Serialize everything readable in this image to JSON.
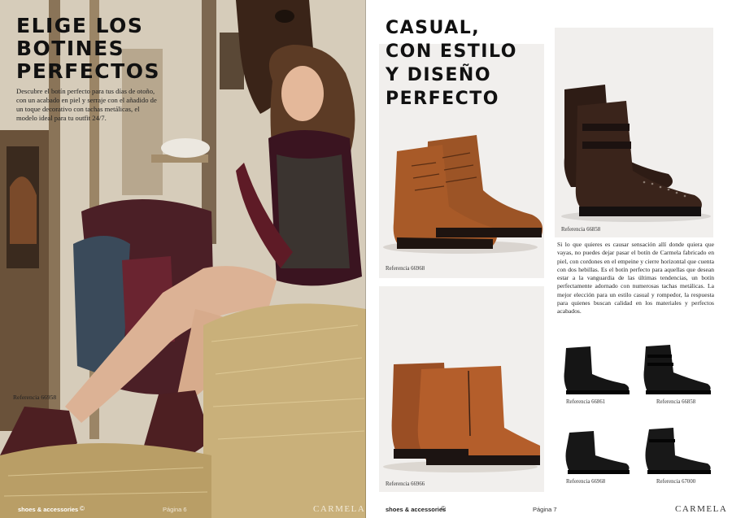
{
  "left_page": {
    "title_lines": [
      "ELIGE LOS",
      "BOTINES",
      "PERFECTOS"
    ],
    "intro": "Descubre el botín perfecto para tus días de otoño, con un acabado en piel y serraje con el añadido de un toque decorativo con tachas metálicas, el modelo ideal para tu outfit 24/7.",
    "reference": "Referencia 66958",
    "footer": {
      "brand": "shoes & accessories",
      "page": "Página 6",
      "logo": "CARMELA"
    }
  },
  "right_page": {
    "title_lines": [
      "CASUAL,",
      "CON ESTILO",
      "Y DISEÑO",
      "PERFECTO"
    ],
    "photos": [
      {
        "reference": "Referencia 66968",
        "color": "#a0562a"
      },
      {
        "reference": "Referencia 66858",
        "color": "#3b231b"
      },
      {
        "reference": "Referencia 66966",
        "color": "#b5602b"
      }
    ],
    "body": "Si lo que quieres es causar sensación allí donde quiera que vayas, no puedes dejar pasar el botín de Carmela fabricado en piel, con cordones en el empeine y cierre horizontal que cuenta con dos hebillas. Es el botín perfecto para aquellas que desean estar a la vanguardia de las últimas tendencias, un botín perfectamente adornado con numerosas tachas metálicas. La mejor elección para un estilo casual y rompedor, la respuesta para quienes buscan calidad en los materiales y perfectos acabados.",
    "mini_boots": [
      {
        "reference": "Referencia 66861"
      },
      {
        "reference": "Referencia 66858"
      },
      {
        "reference": "Referencia 66968"
      },
      {
        "reference": "Referencia 67000"
      }
    ],
    "footer": {
      "brand": "shoes & accessories",
      "page": "Página 7",
      "logo": "CARMELA"
    }
  },
  "icons": {
    "footer_symbol": "copyright-circle-icon"
  }
}
